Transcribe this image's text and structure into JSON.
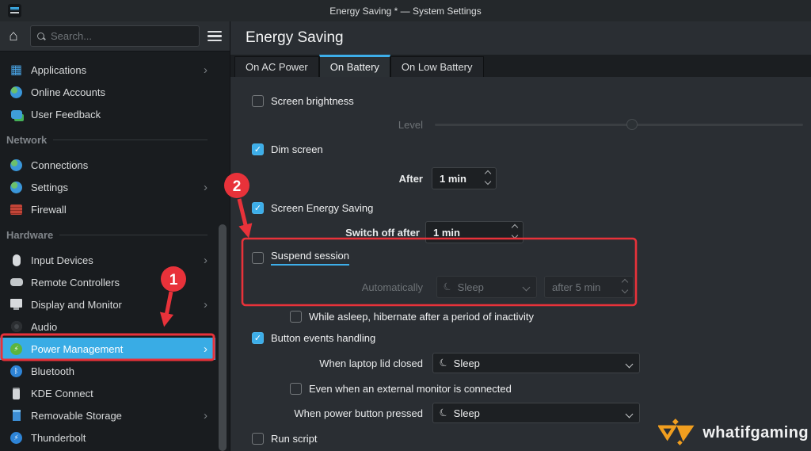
{
  "window": {
    "title": "Energy Saving * — System Settings"
  },
  "glyphs": {
    "chevron_right": "›",
    "home": "⌂",
    "check": "✓",
    "apps": "▦",
    "bolt": "⚡",
    "rune_b": "ᛒ",
    "moon": "☾"
  },
  "sidebar": {
    "search": {
      "placeholder": "Search...",
      "value": ""
    },
    "items": [
      {
        "type": "item",
        "label": "Applications",
        "icon": "applications-icon",
        "chevron": true
      },
      {
        "type": "item",
        "label": "Online Accounts",
        "icon": "online-accounts-icon"
      },
      {
        "type": "item",
        "label": "User Feedback",
        "icon": "user-feedback-icon"
      },
      {
        "type": "header",
        "label": "Network"
      },
      {
        "type": "item",
        "label": "Connections",
        "icon": "connections-icon"
      },
      {
        "type": "item",
        "label": "Settings",
        "icon": "network-settings-icon",
        "chevron": true
      },
      {
        "type": "item",
        "label": "Firewall",
        "icon": "firewall-icon"
      },
      {
        "type": "header",
        "label": "Hardware"
      },
      {
        "type": "item",
        "label": "Input Devices",
        "icon": "input-devices-icon",
        "chevron": true
      },
      {
        "type": "item",
        "label": "Remote Controllers",
        "icon": "remote-controllers-icon"
      },
      {
        "type": "item",
        "label": "Display and Monitor",
        "icon": "display-monitor-icon",
        "chevron": true
      },
      {
        "type": "item",
        "label": "Audio",
        "icon": "audio-icon"
      },
      {
        "type": "item",
        "label": "Power Management",
        "icon": "power-management-icon",
        "chevron": true,
        "selected": true
      },
      {
        "type": "item",
        "label": "Bluetooth",
        "icon": "bluetooth-icon"
      },
      {
        "type": "item",
        "label": "KDE Connect",
        "icon": "kde-connect-icon"
      },
      {
        "type": "item",
        "label": "Removable Storage",
        "icon": "removable-storage-icon",
        "chevron": true
      },
      {
        "type": "item",
        "label": "Thunderbolt",
        "icon": "thunderbolt-icon"
      }
    ]
  },
  "main": {
    "page_title": "Energy Saving",
    "tabs": [
      {
        "label": "On AC Power",
        "active": false
      },
      {
        "label": "On Battery",
        "active": true
      },
      {
        "label": "On Low Battery",
        "active": false
      }
    ],
    "rows": {
      "screen_brightness": {
        "label": "Screen brightness",
        "checked": false
      },
      "level": {
        "label": "Level",
        "percent": 52,
        "enabled": false
      },
      "dim_screen": {
        "label": "Dim screen",
        "checked": true
      },
      "dim_after": {
        "label": "After",
        "value": "1 min"
      },
      "screen_energy_saving": {
        "label": "Screen Energy Saving",
        "checked": true
      },
      "switch_off_after": {
        "label": "Switch off after",
        "value": "1 min"
      },
      "suspend_session": {
        "label": "Suspend session",
        "checked": false
      },
      "automatically": {
        "label": "Automatically",
        "action": "Sleep",
        "delay": "after 5 min",
        "enabled": false
      },
      "hibernate_inactivity": {
        "label": "While asleep, hibernate after a period of inactivity",
        "checked": false
      },
      "button_events": {
        "label": "Button events handling",
        "checked": true
      },
      "lid_closed": {
        "label": "When laptop lid closed",
        "value": "Sleep"
      },
      "external_monitor": {
        "label": "Even when an external monitor is connected",
        "checked": false
      },
      "power_button": {
        "label": "When power button pressed",
        "value": "Sleep"
      },
      "run_script": {
        "label": "Run script",
        "checked": false
      }
    }
  },
  "annotations": {
    "marker_1": "1",
    "marker_2": "2",
    "color": "#e8323a"
  },
  "watermark": {
    "text": "whatifgaming"
  },
  "colors": {
    "accent": "#3daee9",
    "sidebar_highlight": "#39ace5",
    "annotation_red": "#e8323a"
  }
}
